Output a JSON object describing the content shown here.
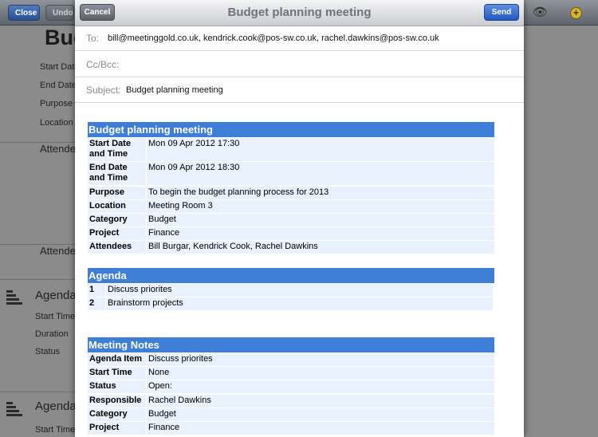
{
  "background": {
    "toolbar": {
      "close_label": "Close",
      "undo_label": "Undo",
      "eye_icon": "eye-icon",
      "add_icon": "add-circle-icon"
    },
    "title_partial": "Bud",
    "labels": [
      "Start Date",
      "End Date",
      "Purpose",
      "Location"
    ],
    "attendees_label_1": "Attende",
    "attendees_label_2": "Attende",
    "agenda_1": {
      "label": "Agenda",
      "sublabels": [
        "Start Time",
        "Duration",
        "Status"
      ]
    },
    "agenda_2": {
      "label": "Agenda",
      "sublabels": [
        "Start Time"
      ]
    }
  },
  "composer": {
    "title": "Budget planning meeting",
    "cancel_label": "Cancel",
    "send_label": "Send",
    "to_label": "To:",
    "to_value": "bill@meetinggold.co.uk, kendrick.cook@pos-sw.co.uk, rachel.dawkins@pos-sw.co.uk",
    "cc_label": "Cc/Bcc:",
    "subject_label": "Subject:",
    "subject_value": "Budget planning meeting",
    "meeting": {
      "heading": "Budget planning meeting",
      "rows": [
        {
          "key": "Start Date and Time",
          "value": "Mon 09 Apr 2012 17:30"
        },
        {
          "key": "End Date and Time",
          "value": "Mon 09 Apr 2012 18:30"
        },
        {
          "key": "Purpose",
          "value": "To begin the budget planning process for 2013"
        },
        {
          "key": "Location",
          "value": "Meeting Room 3"
        },
        {
          "key": "Category",
          "value": "Budget"
        },
        {
          "key": "Project",
          "value": "Finance"
        },
        {
          "key": "Attendees",
          "value": "Bill Burgar, Kendrick Cook, Rachel Dawkins"
        }
      ]
    },
    "agenda": {
      "heading": "Agenda",
      "rows": [
        {
          "key": "1",
          "value": "Discuss priorites"
        },
        {
          "key": "2",
          "value": "Brainstorm projects"
        }
      ]
    },
    "notes": {
      "heading": "Meeting Notes",
      "rows": [
        {
          "key": "Agenda Item",
          "value": "Discuss priorites"
        },
        {
          "key": "Start Time",
          "value": "None"
        },
        {
          "key": "Status",
          "value": "Open:"
        },
        {
          "key": "Responsible",
          "value": "Rachel Dawkins"
        },
        {
          "key": "Category",
          "value": "Budget"
        },
        {
          "key": "Project",
          "value": "Finance"
        }
      ]
    }
  }
}
